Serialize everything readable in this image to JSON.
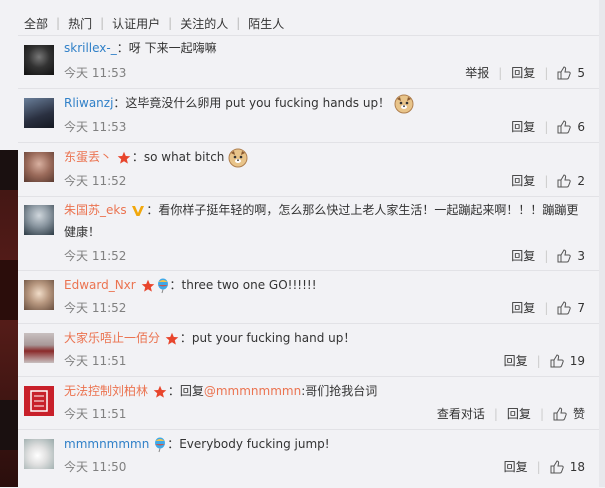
{
  "tabs": [
    "全部",
    "热门",
    "认证用户",
    "关注的人",
    "陌生人"
  ],
  "colors": {
    "name_blue": "#3080c8",
    "name_orange": "#eb7350",
    "time": "#808080",
    "mention": "#eb7350"
  },
  "comments": [
    {
      "user": "skrillex-_",
      "name_color": "#3080c8",
      "text": "：呀 下来一起嗨嘛",
      "time": "今天 11:53",
      "report": "举报",
      "reply": "回复",
      "likes": "5"
    },
    {
      "user": "Rliwanzj",
      "name_color": "#3080c8",
      "text": "：这毕竟没什么卵用 put you fucking hands up！",
      "emoji": "dog-emoji",
      "time": "今天 11:53",
      "reply": "回复",
      "likes": "6"
    },
    {
      "user": "东蛋丢丶",
      "name_color": "#eb7350",
      "badges": [
        "star-badge"
      ],
      "text": "：so what bitch",
      "emoji": "dog-emoji",
      "time": "今天 11:52",
      "reply": "回复",
      "likes": "2"
    },
    {
      "user": "朱国苏_eks",
      "name_color": "#eb7350",
      "badges": [
        "verified-v-badge"
      ],
      "text": "：看你样子挺年轻的啊，怎么那么快过上老人家生活！一起蹦起来啊！！！蹦蹦更",
      "text2": "健康！",
      "time": "今天 11:52",
      "reply": "回复",
      "likes": "3"
    },
    {
      "user": "Edward_Nxr",
      "name_color": "#eb7350",
      "badges": [
        "star-badge",
        "balloon-badge"
      ],
      "text": "：three two one GO!!!!!!",
      "time": "今天 11:52",
      "reply": "回复",
      "likes": "7"
    },
    {
      "user": "大家乐唔止一佰分",
      "name_color": "#eb7350",
      "badges": [
        "star-badge"
      ],
      "text": "：put your fucking hand up！",
      "time": "今天 11:51",
      "reply": "回复",
      "likes": "19"
    },
    {
      "user": "无法控制刘柏林",
      "name_color": "#eb7350",
      "badges": [
        "star-badge"
      ],
      "text_prefix": "：回复",
      "mention": "@mmmnmmmn",
      "text": ":哥们抢我台词",
      "time": "今天 11:51",
      "view_conversation": "查看对话",
      "reply": "回复",
      "likes": "赞"
    },
    {
      "user": "mmmnmmmn",
      "name_color": "#3080c8",
      "badges": [
        "balloon-badge"
      ],
      "text": "：Everybody fucking jump!",
      "time": "今天 11:50",
      "reply": "回复",
      "likes": "18"
    }
  ]
}
